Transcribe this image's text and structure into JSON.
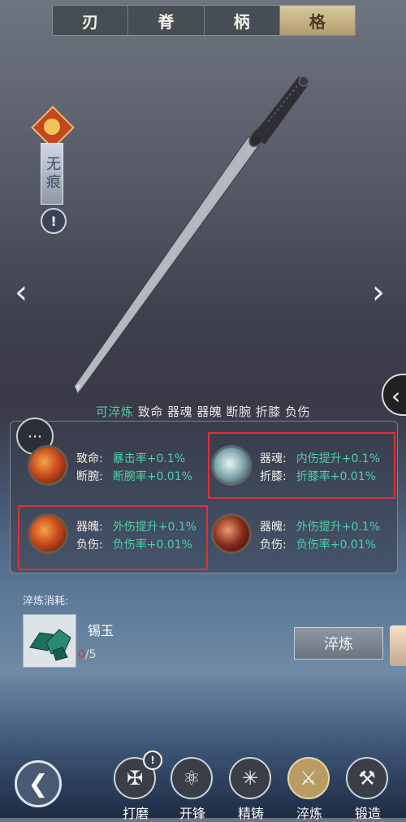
{
  "top_tabs": [
    {
      "label": "刃",
      "active": false
    },
    {
      "label": "脊",
      "active": false
    },
    {
      "label": "柄",
      "active": false
    },
    {
      "label": "格",
      "active": true
    }
  ],
  "weapon": {
    "name": "无痕",
    "alert_icon": "exclamation-icon"
  },
  "tags": {
    "highlight": "可淬炼",
    "items": "致命 器魂 器魄 断腕 折膝 负伤"
  },
  "slots": [
    {
      "k1": "致命:",
      "v1": "暴击率+0.1%",
      "k2": "断腕:",
      "v2": "断腕率+0.01%",
      "icon": "fire",
      "highlighted": false
    },
    {
      "k1": "器魂:",
      "v1": "内伤提升+0.1%",
      "k2": "折膝:",
      "v2": "折膝率+0.01%",
      "icon": "ice",
      "highlighted": true
    },
    {
      "k1": "器魄:",
      "v1": "外伤提升+0.1%",
      "k2": "负伤:",
      "v2": "负伤率+0.01%",
      "icon": "fire",
      "highlighted": true
    },
    {
      "k1": "器魄:",
      "v1": "外伤提升+0.1%",
      "k2": "负伤:",
      "v2": "负伤率+0.01%",
      "icon": "dark",
      "highlighted": false
    }
  ],
  "cost": {
    "label": "淬炼消耗:",
    "item_name": "锡玉",
    "have": "0",
    "need": "/5"
  },
  "refine_button": "淬炼",
  "nav": [
    {
      "label": "打磨",
      "icon": "grind-icon",
      "active": false,
      "badge": "!"
    },
    {
      "label": "开锋",
      "icon": "sharpen-icon",
      "active": false
    },
    {
      "label": "精铸",
      "icon": "cast-icon",
      "active": false
    },
    {
      "label": "淬炼",
      "icon": "temper-icon",
      "active": true
    },
    {
      "label": "锻造",
      "icon": "forge-icon",
      "active": false
    }
  ],
  "colors": {
    "stat_value": "#4fd0a8",
    "active_tab": "#b89c64",
    "highlight_box": "#e0303a"
  }
}
